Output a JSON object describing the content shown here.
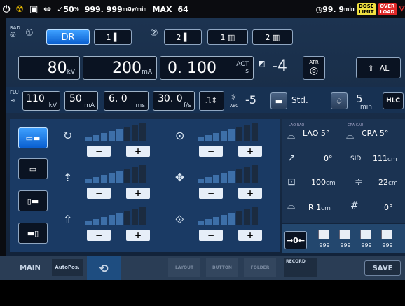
{
  "status_bar": {
    "dose_rate": "50",
    "dose_rate_unit": "%",
    "dose_value": "999. 999",
    "dose_unit": "mGy/min",
    "max_label": "MAX",
    "max_value": "64",
    "timer": "99. 9",
    "timer_unit": "min",
    "dose_limit": "DOSE LIMIT",
    "over_load": "OVER LOAD"
  },
  "rad": {
    "label": "RAD",
    "mode": "DR",
    "sel1": "1",
    "sel2": "2",
    "sel3": "1",
    "sel4": "2",
    "kv": "80",
    "kv_unit": "kV",
    "ma": "200",
    "ma_unit": "mA",
    "time": "0. 100",
    "act": "ACT",
    "time_unit": "s",
    "step": "-4",
    "atr": "ATR",
    "al": "AL"
  },
  "flu": {
    "label": "FLU",
    "kv": "110",
    "kv_unit": "kV",
    "ma": "50",
    "ma_unit": "mA",
    "ms": "6. 0",
    "ms_unit": "ms",
    "fps": "30. 0",
    "fps_unit": "f/s",
    "abc": "-5",
    "abc_label": "ABC",
    "std": "Std.",
    "time": "5",
    "time_unit": "min",
    "hlc": "HLC"
  },
  "right_panel": {
    "lao_label": "LAO RAO",
    "lao": "LAO",
    "lao_val": "5",
    "cra_label": "CRA CAU",
    "cra": "CRA",
    "cra_val": "5",
    "rot": "0",
    "sid_label": "SID",
    "sid": "111",
    "sid_unit": "cm",
    "h1": "100",
    "h1_unit": "cm",
    "h2": "22",
    "h2_unit": "cm",
    "lr": "R",
    "lr_val": "1",
    "lr_unit": "cm",
    "ang": "0",
    "counts": [
      "999",
      "999",
      "999",
      "999"
    ]
  },
  "tabs": {
    "main": "MAIN",
    "autopos": "AutoPos.",
    "layout": "LAYOUT",
    "button": "BUTTON",
    "folder": "FOLDER",
    "record": "RECORD",
    "save": "SAVE"
  }
}
